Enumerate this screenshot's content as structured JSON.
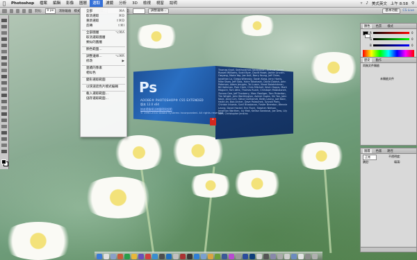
{
  "menubar": {
    "app_name": "Photoshop",
    "items": [
      "檔案",
      "編輯",
      "影像",
      "圖層",
      "選取",
      "濾鏡",
      "分析",
      "3D",
      "檢視",
      "視窗",
      "說明"
    ],
    "active_index": 4,
    "status": {
      "input_method": "美式英文",
      "clock": "上午 8:58",
      "user": "CS Live"
    }
  },
  "optbar": {
    "feather_label": "羽化:",
    "feather_value": "0 px",
    "antialias_label": "消除鋸齒",
    "style_label": "樣式:",
    "style_value": "正常",
    "width_label": "寬度:",
    "height_label": "高度:",
    "refine_button": "調整邊緣...",
    "workspace": "基本功能",
    "search_icon": "search-icon"
  },
  "select_menu": {
    "items": [
      {
        "label": "全部",
        "key": "⌘A",
        "disabled": false
      },
      {
        "label": "取消選取",
        "key": "⌘D",
        "disabled": false
      },
      {
        "label": "重新選取",
        "key": "⇧⌘D",
        "disabled": false
      },
      {
        "label": "反轉",
        "key": "⇧⌘I",
        "disabled": false
      },
      {
        "sep": true
      },
      {
        "label": "全部圖層",
        "key": "⌥⌘A",
        "disabled": false
      },
      {
        "label": "取消選取圖層",
        "key": "",
        "disabled": false
      },
      {
        "label": "類似的圖層",
        "key": "",
        "disabled": false
      },
      {
        "sep": true
      },
      {
        "label": "顏色範圍...",
        "key": "",
        "disabled": false
      },
      {
        "sep": true
      },
      {
        "label": "調整邊緣...",
        "key": "⌥⌘R",
        "disabled": false
      },
      {
        "label": "修改",
        "key": "▶",
        "disabled": false
      },
      {
        "sep": true
      },
      {
        "label": "連續的像素",
        "key": "",
        "disabled": false
      },
      {
        "label": "相似色",
        "key": "",
        "disabled": false
      },
      {
        "sep": true
      },
      {
        "label": "變形選取範圍",
        "key": "",
        "disabled": false
      },
      {
        "sep": true
      },
      {
        "label": "以快速遮色片模式編輯",
        "key": "",
        "disabled": false
      },
      {
        "sep": true
      },
      {
        "label": "載入選取範圍...",
        "key": "",
        "disabled": false
      },
      {
        "label": "儲存選取範圍...",
        "key": "",
        "disabled": false
      }
    ]
  },
  "splash": {
    "logo": "Ps",
    "product": "ADOBE® PHOTOSHOP® CS5 EXTENDED",
    "version": "版本 12.0 x64",
    "legal_link": "按這裡檢視法律聲明與說明",
    "copyright": "© 1990-2010 Adobe Systems Incorporated. All rights reserved.",
    "credits": "Thomas Knoll, Seetharaman Narayanan, Andrew Coven, Russell Williams, Scott Byer, David Howe, Jackie Lincoln-Owyang, Maria Yap, Joe Ault, Barry Young, Jeff Chien, Jonathan Lo, Gregg Wilensky, Sarah Kong, Jerry Harris, Mike Shaw, Jeff Sass, Yukie Takahashi, David Dobish, John Peterson, Adam Jerugim, Tai Luxon, Vinod Balakrishnan, Bill Kolkman, Pam Clark, Chris Mitchell, Kevin Hopps, Mark Maguire, Tom Attix, Thomas Ruark, Christoph Moskalonek, Zorana Gee, Jeff Tranberry, Marc Pawliger, Tom Pinkerton, Tim Wright, John Worthington, Ashish Gupta, Shi Yan, John Nack, Anne Lim, Steve Guilhamet, Betty Leong, Joel Baer, Hailin Jin, Bob Archer, Dave Polaschek, Sylvain Paris, Chintan Intwala, Sunil Bhaskaran, Foster Brereton, Wennie Leung, David Hackel, Eric Floch, Stephen Nielson, Jonathan Worthen, Ivy Mak, Kellisa Sandoval, Joe Dew, Lily Wen, Christopher Jenkins"
  },
  "panels": {
    "color": {
      "tabs": [
        "顏色",
        "色票",
        "樣式"
      ],
      "channels": [
        "R",
        "G",
        "B"
      ],
      "values": [
        "0",
        "0",
        "0"
      ]
    },
    "history": {
      "tabs": [
        "歷史",
        "動作"
      ],
      "document": "尚無文件開啟",
      "empty_text": "未開啟文件"
    },
    "layers": {
      "tabs": [
        "圖層",
        "色版",
        "路徑"
      ],
      "blend_mode": "正常",
      "opacity_label": "不透明度:",
      "lock_label": "鎖定:",
      "fill_label": "填滿:"
    }
  }
}
